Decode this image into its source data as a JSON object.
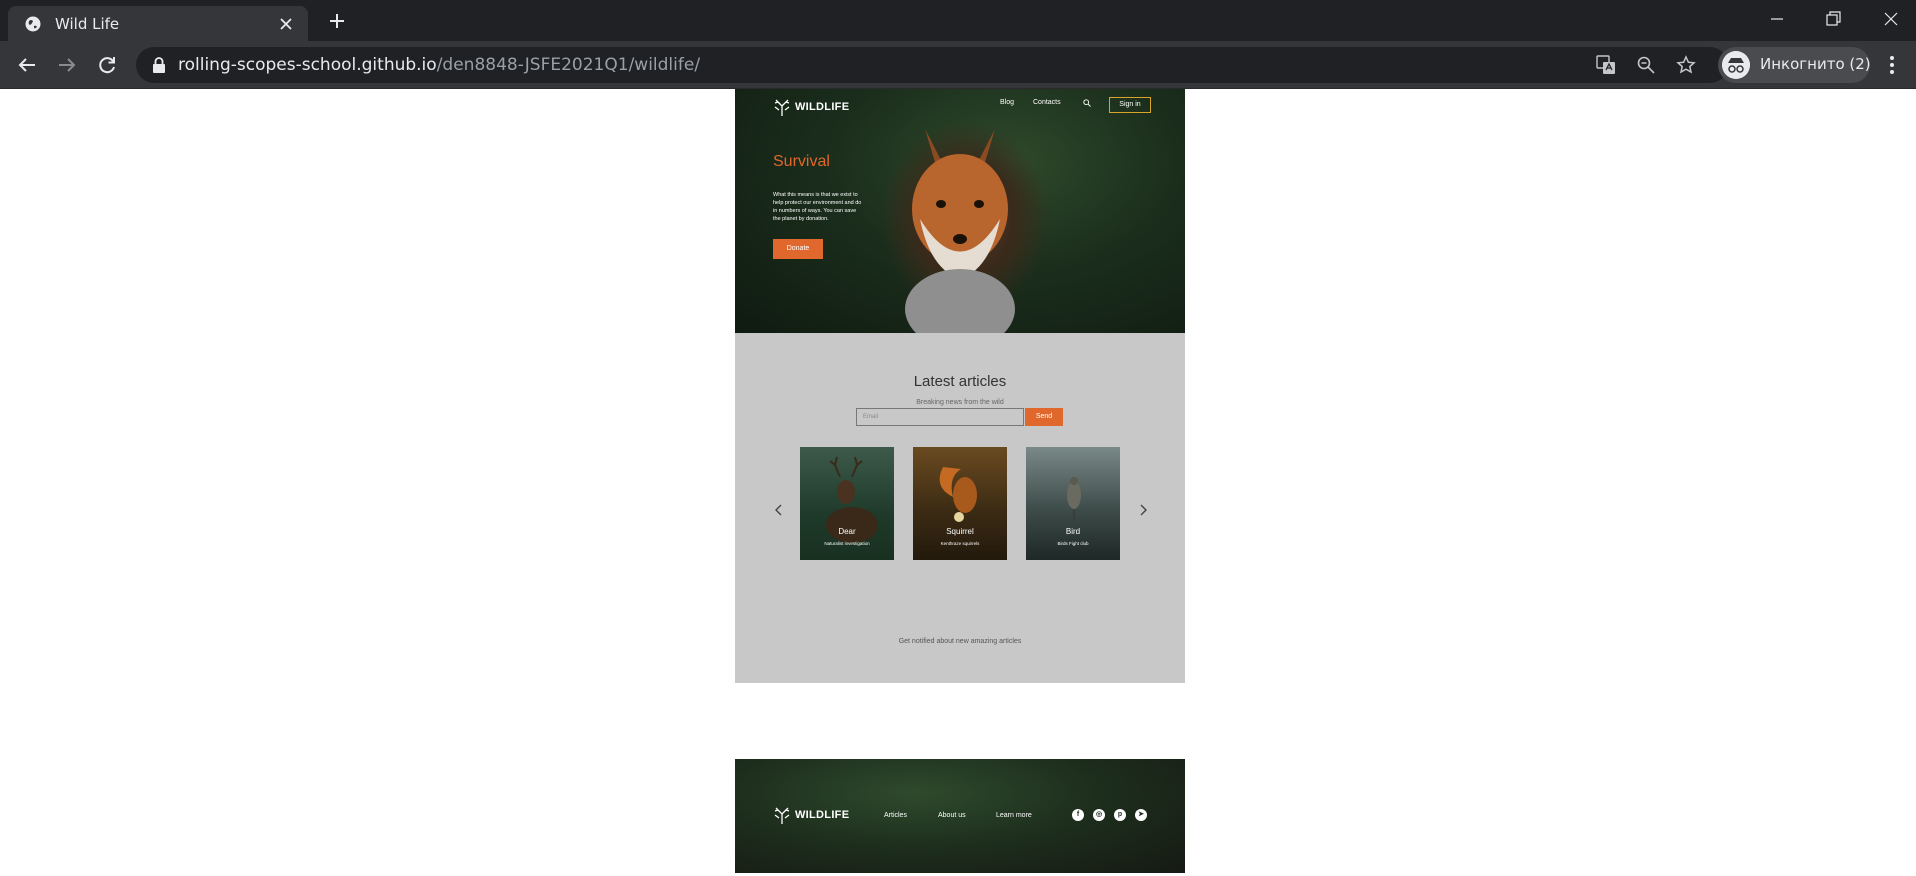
{
  "browser": {
    "tab_title": "Wild Life",
    "url_host": "rolling-scopes-school.github.io",
    "url_path": "/den8848-JSFE2021Q1/wildlife/",
    "profile_label": "Инкогнито (2)"
  },
  "header": {
    "logo_text": "WILDLIFE",
    "nav": [
      "Blog",
      "Contacts"
    ],
    "signin_label": "Sign in"
  },
  "hero": {
    "title": "Survival",
    "text": "What this means is that we exist to help protect our environment and do in numbers of ways. You can save the planet by donation.",
    "donate_label": "Donate"
  },
  "articles": {
    "title": "Latest articles",
    "subtitle": "Breaking news from the wild",
    "cards": [
      {
        "title": "Dear",
        "subtitle": "Naturalist investigation"
      },
      {
        "title": "Squirrel",
        "subtitle": "Kenthraze squirrels"
      },
      {
        "title": "Bird",
        "subtitle": "Birds Fight club"
      }
    ]
  },
  "signup": {
    "text": "Get notified about new amazing articles",
    "email_placeholder": "Email",
    "send_label": "Send"
  },
  "footer": {
    "logo_text": "WILDLIFE",
    "nav": [
      "Articles",
      "About us",
      "Learn more"
    ],
    "social": [
      "facebook-icon",
      "instagram-icon",
      "pinterest-icon",
      "telegram-icon"
    ]
  },
  "colors": {
    "accent": "#e0682c",
    "signin_border": "#d9a42a",
    "articles_bg": "#c8c8c8",
    "chrome_bg": "#202124"
  }
}
